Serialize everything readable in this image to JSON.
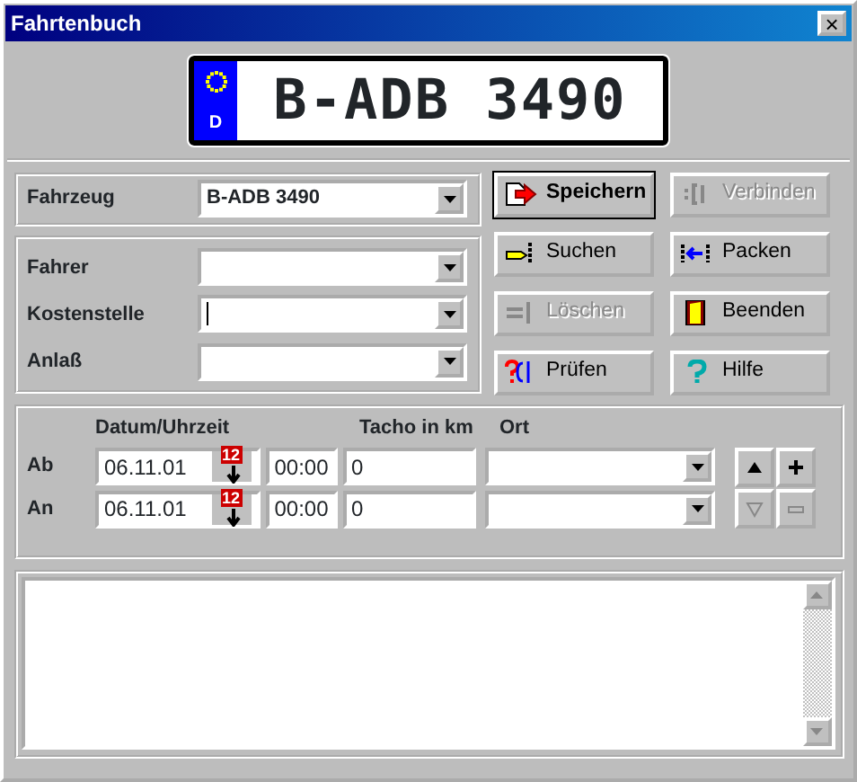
{
  "window": {
    "title": "Fahrtenbuch",
    "close": "×"
  },
  "plate": {
    "country": "D",
    "number": "B-ADB 3490"
  },
  "vehicle": {
    "label": "Fahrzeug",
    "value": "B-ADB 3490"
  },
  "fields": [
    {
      "label": "Fahrer",
      "focused": false
    },
    {
      "label": "Kostenstelle",
      "focused": true
    },
    {
      "label": "Anlaß",
      "focused": false
    }
  ],
  "buttons": [
    {
      "label": "Speichern",
      "kind": "save",
      "disabled": false,
      "default": true
    },
    {
      "label": "Verbinden",
      "kind": "connect",
      "disabled": true,
      "default": false
    },
    {
      "label": "Suchen",
      "kind": "search",
      "disabled": false,
      "default": false
    },
    {
      "label": "Packen",
      "kind": "pack",
      "disabled": false,
      "default": false
    },
    {
      "label": "Löschen",
      "kind": "delete",
      "disabled": true,
      "default": false
    },
    {
      "label": "Beenden",
      "kind": "exit",
      "disabled": false,
      "default": false
    },
    {
      "label": "Prüfen",
      "kind": "check",
      "disabled": false,
      "default": false
    },
    {
      "label": "Hilfe",
      "kind": "help",
      "disabled": false,
      "default": false
    }
  ],
  "trip": {
    "headers": [
      "Datum/Uhrzeit",
      "Tacho in km",
      "Ort"
    ],
    "rows": [
      {
        "label": "Ab",
        "date": "06.11.01",
        "calendar": "12",
        "time": "00:00",
        "odometer": "0"
      },
      {
        "label": "An",
        "date": "06.11.01",
        "calendar": "12",
        "time": "00:00",
        "odometer": "0"
      }
    ],
    "nav": [
      {
        "kind": "up",
        "disabled": false
      },
      {
        "kind": "plus",
        "disabled": false
      },
      {
        "kind": "down",
        "disabled": true
      },
      {
        "kind": "minus",
        "disabled": true
      }
    ]
  }
}
